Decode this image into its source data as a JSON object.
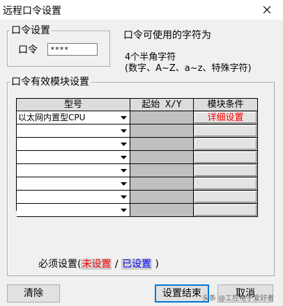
{
  "window": {
    "title": "远程口令设置",
    "close_glyph": "✕"
  },
  "password_group": {
    "legend": "口令设置",
    "field_label": "口令",
    "field_value": "****"
  },
  "info": {
    "heading": "口令可使用的字符为",
    "line1": "4个半角字符",
    "line2": "(数字、A~Z、a~z、特殊字符)"
  },
  "module_group": {
    "legend": "口令有效模块设置",
    "columns": {
      "model": "型号",
      "start": "起始 X/Y",
      "condition": "模块条件"
    },
    "rows": [
      {
        "model": "以太网内置型CPU",
        "start": "",
        "condition": "详细设置"
      },
      {
        "model": "",
        "start": "",
        "condition": ""
      },
      {
        "model": "",
        "start": "",
        "condition": ""
      },
      {
        "model": "",
        "start": "",
        "condition": ""
      },
      {
        "model": "",
        "start": "",
        "condition": ""
      },
      {
        "model": "",
        "start": "",
        "condition": ""
      },
      {
        "model": "",
        "start": "",
        "condition": ""
      },
      {
        "model": "",
        "start": "",
        "condition": ""
      }
    ]
  },
  "status_legend": {
    "prefix": "必须设置(",
    "unset": "未设置",
    "sep": "/",
    "set": "已设置",
    "suffix": ")"
  },
  "buttons": {
    "clear": "清除",
    "finish": "设置结束",
    "cancel": "取消"
  },
  "watermark": "头条 @工控电子爱好者",
  "colors": {
    "unset": "#ff0000",
    "set": "#0000ff"
  }
}
